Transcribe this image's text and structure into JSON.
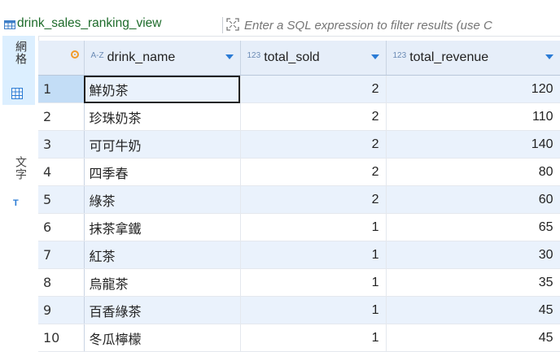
{
  "toolbar": {
    "view_name": "drink_sales_ranking_view",
    "filter_placeholder": "Enter a SQL expression to filter results (use C"
  },
  "side_panel": {
    "grid_tab": "網格",
    "text_tab": "文字",
    "text_tab_icon": "T"
  },
  "columns": [
    {
      "type_tag": "A-Z",
      "label": "drink_name"
    },
    {
      "type_tag": "123",
      "label": "total_sold"
    },
    {
      "type_tag": "123",
      "label": "total_revenue"
    }
  ],
  "rows": [
    {
      "num": "1",
      "drink_name": "鮮奶茶",
      "total_sold": "2",
      "total_revenue": "120"
    },
    {
      "num": "2",
      "drink_name": "珍珠奶茶",
      "total_sold": "2",
      "total_revenue": "110"
    },
    {
      "num": "3",
      "drink_name": "可可牛奶",
      "total_sold": "2",
      "total_revenue": "140"
    },
    {
      "num": "4",
      "drink_name": "四季春",
      "total_sold": "2",
      "total_revenue": "80"
    },
    {
      "num": "5",
      "drink_name": "綠茶",
      "total_sold": "2",
      "total_revenue": "60"
    },
    {
      "num": "6",
      "drink_name": "抹茶拿鐵",
      "total_sold": "1",
      "total_revenue": "65"
    },
    {
      "num": "7",
      "drink_name": "紅茶",
      "total_sold": "1",
      "total_revenue": "30"
    },
    {
      "num": "8",
      "drink_name": "烏龍茶",
      "total_sold": "1",
      "total_revenue": "35"
    },
    {
      "num": "9",
      "drink_name": "百香綠茶",
      "total_sold": "1",
      "total_revenue": "45"
    },
    {
      "num": "10",
      "drink_name": "冬瓜檸檬",
      "total_sold": "1",
      "total_revenue": "45"
    }
  ]
}
